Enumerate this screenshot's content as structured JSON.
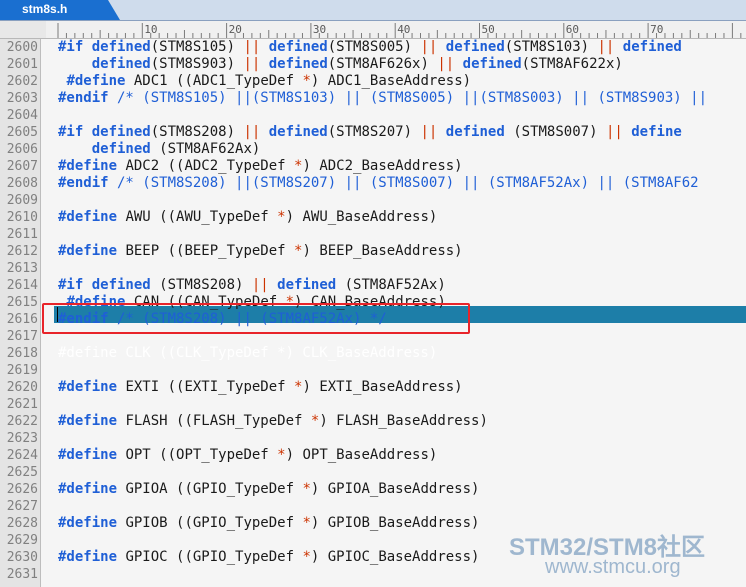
{
  "tab": {
    "filename": "stm8s.h"
  },
  "ruler": {
    "labels": [
      "10",
      "20",
      "30",
      "40",
      "50",
      "60",
      "70"
    ]
  },
  "lines": [
    {
      "num": "2600",
      "tokens": [
        [
          "kw",
          "#if defined"
        ],
        [
          "",
          "(STM8S105) "
        ],
        [
          "op",
          "||"
        ],
        [
          "",
          " "
        ],
        [
          "kw",
          "defined"
        ],
        [
          "",
          "(STM8S005) "
        ],
        [
          "op",
          "||"
        ],
        [
          "",
          " "
        ],
        [
          "kw",
          "defined"
        ],
        [
          "",
          "(STM8S103) "
        ],
        [
          "op",
          "||"
        ],
        [
          "",
          " "
        ],
        [
          "kw",
          "defined"
        ]
      ]
    },
    {
      "num": "2601",
      "tokens": [
        [
          "",
          "    "
        ],
        [
          "kw",
          "defined"
        ],
        [
          "",
          "(STM8S903) "
        ],
        [
          "op",
          "||"
        ],
        [
          "",
          " "
        ],
        [
          "kw",
          "defined"
        ],
        [
          "",
          "(STM8AF626x) "
        ],
        [
          "op",
          "||"
        ],
        [
          "",
          " "
        ],
        [
          "kw",
          "defined"
        ],
        [
          "",
          "(STM8AF622x)"
        ]
      ]
    },
    {
      "num": "2602",
      "tokens": [
        [
          "",
          " "
        ],
        [
          "kw",
          "#define"
        ],
        [
          "",
          " ADC1 ((ADC1_TypeDef "
        ],
        [
          "op",
          "*"
        ],
        [
          "",
          ") ADC1_BaseAddress)"
        ]
      ]
    },
    {
      "num": "2603",
      "tokens": [
        [
          "kw",
          "#endif"
        ],
        [
          "cm",
          " /* (STM8S105) ||(STM8S103) || (STM8S005) ||(STM8S003) || (STM8S903) ||"
        ]
      ]
    },
    {
      "num": "2604",
      "tokens": []
    },
    {
      "num": "2605",
      "tokens": [
        [
          "kw",
          "#if defined"
        ],
        [
          "",
          "(STM8S208) "
        ],
        [
          "op",
          "||"
        ],
        [
          "",
          " "
        ],
        [
          "kw",
          "defined"
        ],
        [
          "",
          "(STM8S207) "
        ],
        [
          "op",
          "||"
        ],
        [
          "",
          " "
        ],
        [
          "kw",
          "defined"
        ],
        [
          "",
          " (STM8S007) "
        ],
        [
          "op",
          "||"
        ],
        [
          "",
          " "
        ],
        [
          "kw",
          "define"
        ]
      ]
    },
    {
      "num": "2606",
      "tokens": [
        [
          "",
          "    "
        ],
        [
          "kw",
          "defined"
        ],
        [
          "",
          " (STM8AF62Ax)"
        ]
      ]
    },
    {
      "num": "2607",
      "tokens": [
        [
          "kw",
          "#define"
        ],
        [
          "",
          " ADC2 ((ADC2_TypeDef "
        ],
        [
          "op",
          "*"
        ],
        [
          "",
          ") ADC2_BaseAddress)"
        ]
      ]
    },
    {
      "num": "2608",
      "tokens": [
        [
          "kw",
          "#endif"
        ],
        [
          "cm",
          " /* (STM8S208) ||(STM8S207) || (STM8S007) || (STM8AF52Ax) || (STM8AF62"
        ]
      ]
    },
    {
      "num": "2609",
      "tokens": []
    },
    {
      "num": "2610",
      "tokens": [
        [
          "kw",
          "#define"
        ],
        [
          "",
          " AWU ((AWU_TypeDef "
        ],
        [
          "op",
          "*"
        ],
        [
          "",
          ") AWU_BaseAddress)"
        ]
      ]
    },
    {
      "num": "2611",
      "tokens": []
    },
    {
      "num": "2612",
      "tokens": [
        [
          "kw",
          "#define"
        ],
        [
          "",
          " BEEP ((BEEP_TypeDef "
        ],
        [
          "op",
          "*"
        ],
        [
          "",
          ") BEEP_BaseAddress)"
        ]
      ]
    },
    {
      "num": "2613",
      "tokens": []
    },
    {
      "num": "2614",
      "tokens": [
        [
          "kw",
          "#if defined"
        ],
        [
          "",
          " (STM8S208) "
        ],
        [
          "op",
          "||"
        ],
        [
          "",
          " "
        ],
        [
          "kw",
          "defined"
        ],
        [
          "",
          " (STM8AF52Ax)"
        ]
      ]
    },
    {
      "num": "2615",
      "tokens": [
        [
          "",
          " "
        ],
        [
          "kw",
          "#define"
        ],
        [
          "",
          " CAN ((CAN_TypeDef "
        ],
        [
          "op",
          "*"
        ],
        [
          "",
          ") CAN_BaseAddress)"
        ]
      ]
    },
    {
      "num": "2616",
      "tokens": [
        [
          "kw",
          "#endif"
        ],
        [
          "cm",
          " /* (STM8S208) || (STM8AF52Ax) */"
        ]
      ]
    },
    {
      "num": "2617",
      "tokens": []
    },
    {
      "num": "2618",
      "selected": true,
      "tokens": [
        [
          "",
          "#define CLK ((CLK_TypeDef *) CLK_BaseAddress)"
        ]
      ]
    },
    {
      "num": "2619",
      "tokens": []
    },
    {
      "num": "2620",
      "tokens": [
        [
          "kw",
          "#define"
        ],
        [
          "",
          " EXTI ((EXTI_TypeDef "
        ],
        [
          "op",
          "*"
        ],
        [
          "",
          ") EXTI_BaseAddress)"
        ]
      ]
    },
    {
      "num": "2621",
      "tokens": []
    },
    {
      "num": "2622",
      "tokens": [
        [
          "kw",
          "#define"
        ],
        [
          "",
          " FLASH ((FLASH_TypeDef "
        ],
        [
          "op",
          "*"
        ],
        [
          "",
          ") FLASH_BaseAddress)"
        ]
      ]
    },
    {
      "num": "2623",
      "tokens": []
    },
    {
      "num": "2624",
      "tokens": [
        [
          "kw",
          "#define"
        ],
        [
          "",
          " OPT ((OPT_TypeDef "
        ],
        [
          "op",
          "*"
        ],
        [
          "",
          ") OPT_BaseAddress)"
        ]
      ]
    },
    {
      "num": "2625",
      "tokens": []
    },
    {
      "num": "2626",
      "tokens": [
        [
          "kw",
          "#define"
        ],
        [
          "",
          " GPIOA ((GPIO_TypeDef "
        ],
        [
          "op",
          "*"
        ],
        [
          "",
          ") GPIOA_BaseAddress)"
        ]
      ]
    },
    {
      "num": "2627",
      "tokens": []
    },
    {
      "num": "2628",
      "tokens": [
        [
          "kw",
          "#define"
        ],
        [
          "",
          " GPIOB ((GPIO_TypeDef "
        ],
        [
          "op",
          "*"
        ],
        [
          "",
          ") GPIOB_BaseAddress)"
        ]
      ]
    },
    {
      "num": "2629",
      "tokens": []
    },
    {
      "num": "2630",
      "tokens": [
        [
          "kw",
          "#define"
        ],
        [
          "",
          " GPIOC ((GPIO_TypeDef "
        ],
        [
          "op",
          "*"
        ],
        [
          "",
          ") GPIOC_BaseAddress)"
        ]
      ]
    },
    {
      "num": "2631",
      "tokens": []
    }
  ],
  "watermark": {
    "brand": "STM32/STM8社区",
    "url": "www.stmcu.org"
  },
  "colors": {
    "keyword": "#1f5fd6",
    "operator": "#cc3300",
    "selection": "#1d7ea8",
    "highlight_box": "#e8242a"
  }
}
